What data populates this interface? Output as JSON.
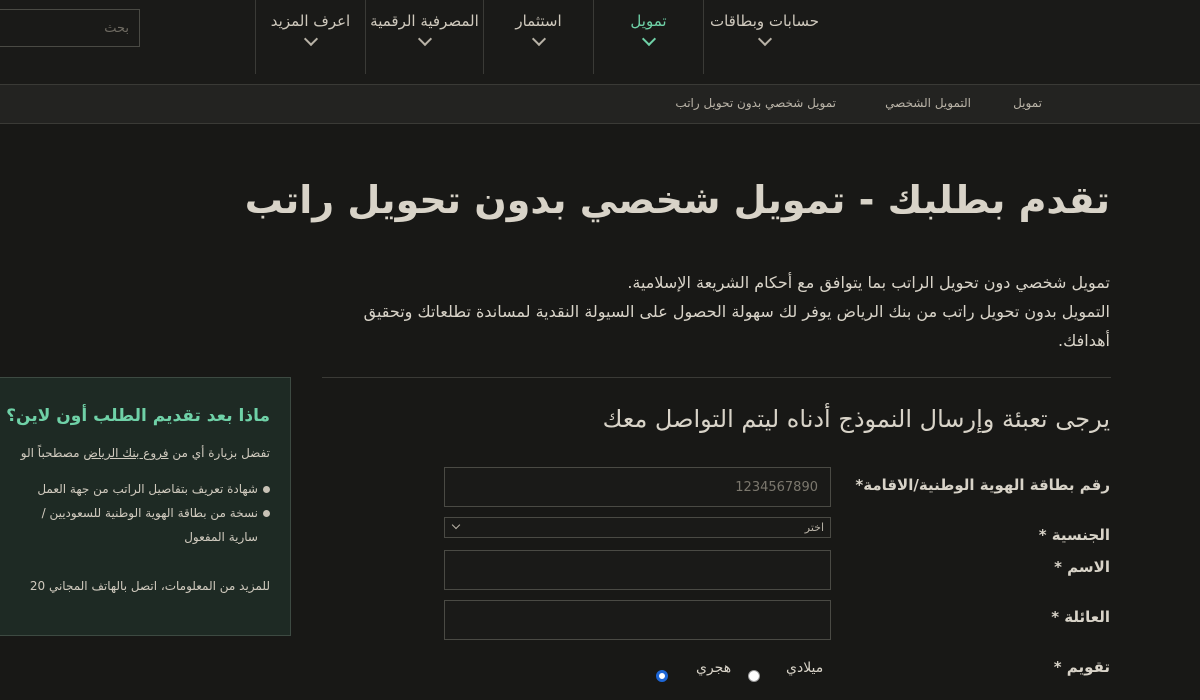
{
  "search": {
    "placeholder": "بحث"
  },
  "nav": {
    "items": [
      {
        "label": "حسابات وبطاقات"
      },
      {
        "label": "تمويل"
      },
      {
        "label": "استثمار"
      },
      {
        "label": "المصرفية الرقمية"
      },
      {
        "label": "اعرف المزيد"
      }
    ],
    "active_color": "#6fd1a7"
  },
  "breadcrumb": [
    {
      "label": "تمويل"
    },
    {
      "label": "التمويل الشخصي"
    },
    {
      "label": "تمويل شخصي بدون تحويل راتب"
    }
  ],
  "page": {
    "title": "تقدم بطلبك - تمويل شخصي بدون تحويل راتب",
    "intro_line1": "تمويل شخصي دون تحويل الراتب بما يتوافق مع أحكام الشريعة الإسلامية.",
    "intro_line2": "التمويل بدون تحويل راتب من بنك الرياض يوفر لك سهولة الحصول على السيولة النقدية لمساندة تطلعاتك وتحقيق أهدافك."
  },
  "form": {
    "title": "يرجى تعبئة وإرسال النموذج أدناه ليتم التواصل معك",
    "id_label": "رقم بطاقة الهوية الوطنية/الاقامة*",
    "id_placeholder": "1234567890",
    "nationality_label": "الجنسية *",
    "nationality_selected": "اختر",
    "name_label": "الاسم *",
    "family_label": "العائلة *",
    "calendar_label": "تقويم *",
    "calendar_options": [
      {
        "label": "ميلادي",
        "selected": false
      },
      {
        "label": "هجري",
        "selected": true
      }
    ]
  },
  "sidebar": {
    "title": "ماذا بعد تقديم الطلب أون لاين؟",
    "visit_prefix": "تفضل بزيارة أي من",
    "visit_link": "فروع بنك الرياض",
    "visit_suffix": "مصطحباً الو",
    "doc1": "شهادة تعريف بتفاصيل الراتب من جهة العمل",
    "doc2": "نسخة من بطاقة الهوية الوطنية للسعوديين /",
    "doc2_cont": "سارية المفعول",
    "contact": "للمزيد من المعلومات، اتصل بالهاتف المجاني 20"
  }
}
